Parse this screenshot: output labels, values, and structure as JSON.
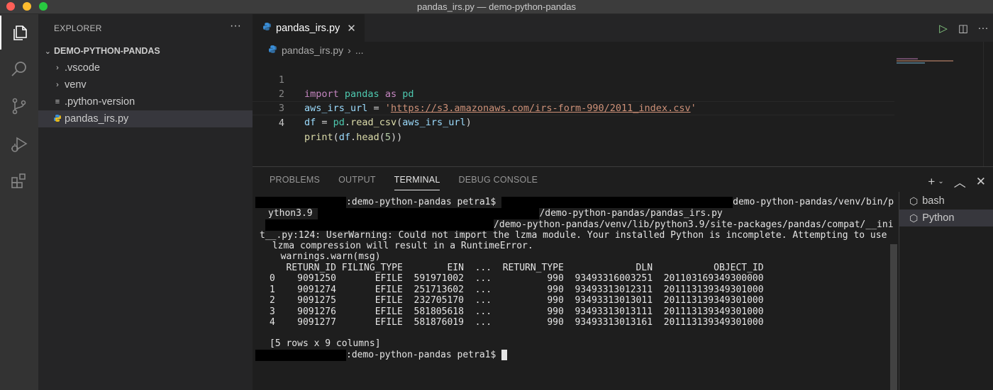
{
  "window": {
    "title": "pandas_irs.py — demo-python-pandas"
  },
  "activity_bar": {
    "icons": [
      "files-icon",
      "search-icon",
      "source-control-icon",
      "run-debug-icon",
      "extensions-icon"
    ]
  },
  "sidebar": {
    "header": "EXPLORER",
    "more": "···",
    "folder": "DEMO-PYTHON-PANDAS",
    "items": [
      {
        "label": ".vscode",
        "icon": "chevron-right-icon",
        "glyph": "›"
      },
      {
        "label": "venv",
        "icon": "chevron-right-icon",
        "glyph": "›"
      },
      {
        "label": ".python-version",
        "icon": "lines-file-icon",
        "glyph": "≡"
      },
      {
        "label": "pandas_irs.py",
        "icon": "python-file-icon",
        "glyph": ""
      }
    ]
  },
  "editor": {
    "tab_label": "pandas_irs.py",
    "tab_close": "✕",
    "breadcrumb_file": "pandas_irs.py",
    "breadcrumb_sep": "›",
    "breadcrumb_more": "...",
    "line_numbers": [
      "1",
      "2",
      "3",
      "4"
    ],
    "code": {
      "l1": {
        "kw_import": "import",
        "module": "pandas",
        "kw_as": "as",
        "alias": "pd"
      },
      "l2": {
        "var": "aws_irs_url",
        "eq": " = ",
        "q1": "'",
        "url": "https://s3.amazonaws.com/irs-form-990/2011_index.csv",
        "q2": "'"
      },
      "l3": {
        "var": "df",
        "eq": " = ",
        "obj": "pd",
        "dot": ".",
        "fn": "read_csv",
        "open": "(",
        "arg": "aws_irs_url",
        "close": ")"
      },
      "l4": {
        "fn": "print",
        "open": "(",
        "obj": "df",
        "dot": ".",
        "method": "head",
        "open2": "(",
        "num": "5",
        "close": "))"
      }
    }
  },
  "panel": {
    "tabs": [
      "PROBLEMS",
      "OUTPUT",
      "TERMINAL",
      "DEBUG CONSOLE"
    ],
    "active_tab": "TERMINAL",
    "actions": {
      "add": "+",
      "dropdown": "⌄",
      "maximize": "︿",
      "close": "✕"
    },
    "terminal": {
      "lines": [
        ":demo-python-pandas petra1$ ",
        "demo-python-pandas/venv/bin/p",
        "ython3.9 ",
        "/demo-python-pandas/pandas_irs.py",
        "/demo-python-pandas/venv/lib/python3.9/site-packages/pandas/compat/__ini",
        "t__.py:124: UserWarning: Could not import the lzma module. Your installed Python is incomplete. Attempting to use",
        " lzma compression will result in a RuntimeError.",
        "  warnings.warn(msg)",
        "   RETURN_ID FILING_TYPE        EIN  ...  RETURN_TYPE             DLN           OBJECT_ID",
        "0    9091250       EFILE  591971002  ...          990  93493316003251  201103169349300000",
        "1    9091274       EFILE  251713602  ...          990  93493313012311  201113139349301000",
        "2    9091275       EFILE  232705170  ...          990  93493313013011  201113139349301000",
        "3    9091276       EFILE  581805618  ...          990  93493313013111  201113139349301000",
        "4    9091277       EFILE  581876019  ...          990  93493313013161  201113139349301000",
        "",
        "[5 rows x 9 columns]",
        ":demo-python-pandas petra1$ "
      ]
    },
    "terminal_list": [
      {
        "label": "bash",
        "icon": "terminal-cube-icon"
      },
      {
        "label": "Python",
        "icon": "terminal-cube-icon"
      }
    ]
  }
}
